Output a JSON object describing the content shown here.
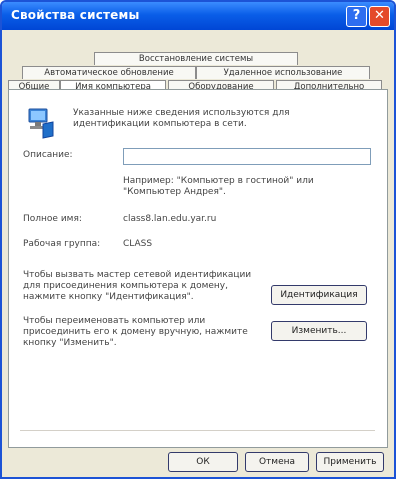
{
  "window": {
    "title": "Свойства системы"
  },
  "tabs": [
    {
      "label": "Восстановление системы"
    },
    {
      "label": "Автоматическое обновление"
    },
    {
      "label": "Удаленное использование"
    },
    {
      "label": "Общие"
    },
    {
      "label": "Имя компьютера"
    },
    {
      "label": "Оборудование"
    },
    {
      "label": "Дополнительно"
    }
  ],
  "intro": "Указанные ниже сведения используются для идентификации компьютера в сети.",
  "description": {
    "label": "Описание:",
    "value": "",
    "hint": "Например: \"Компьютер в гостиной\" или \"Компьютер Андрея\"."
  },
  "full_name": {
    "label": "Полное имя:",
    "value": "class8.lan.edu.yar.ru"
  },
  "workgroup": {
    "label": "Рабочая группа:",
    "value": "CLASS"
  },
  "network_id": {
    "text": "Чтобы вызвать мастер сетевой идентификации для присоединения компьютера к домену, нажмите кнопку \"Идентификация\".",
    "button": "Идентификация"
  },
  "rename": {
    "text": "Чтобы переименовать компьютер или присоединить его к домену вручную, нажмите кнопку \"Изменить\".",
    "button": "Изменить..."
  },
  "footer": {
    "ok": "ОК",
    "cancel": "Отмена",
    "apply": "Применить"
  }
}
